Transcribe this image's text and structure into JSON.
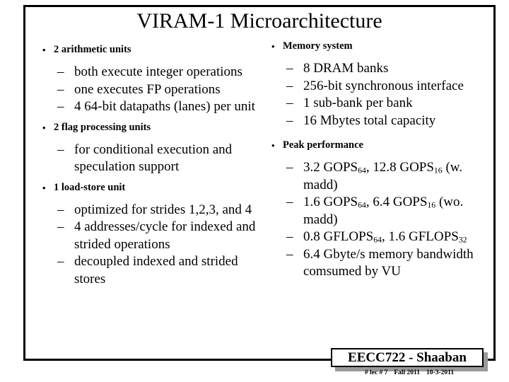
{
  "slide": {
    "title": "VIRAM-1 Microarchitecture",
    "left_column": [
      {
        "type": "bullet",
        "marker": "•",
        "text": "2 arithmetic units",
        "children": [
          {
            "marker": "–",
            "text": "both execute integer operations"
          },
          {
            "marker": "–",
            "text": "one executes FP operations"
          },
          {
            "marker": "–",
            "text": "4 64-bit datapaths (lanes) per unit"
          }
        ]
      },
      {
        "type": "bullet",
        "marker": "•",
        "text": "2 flag processing units",
        "children": [
          {
            "marker": "–",
            "text": "for conditional execution and speculation support"
          }
        ]
      },
      {
        "type": "bullet",
        "marker": "•",
        "text": "1 load-store unit",
        "children": [
          {
            "marker": "–",
            "text": "optimized for strides 1,2,3, and 4"
          },
          {
            "marker": "–",
            "text": "4 addresses/cycle for indexed and strided operations"
          },
          {
            "marker": "–",
            "text": "decoupled indexed and strided stores"
          }
        ]
      }
    ],
    "right_column": [
      {
        "type": "bullet",
        "marker": "•",
        "text": "Memory system",
        "children": [
          {
            "marker": "–",
            "text": "8 DRAM banks"
          },
          {
            "marker": "–",
            "text": "256-bit synchronous interface"
          },
          {
            "marker": "–",
            "text": "1 sub-bank per bank"
          },
          {
            "marker": "–",
            "text": "16 Mbytes total capacity"
          }
        ]
      },
      {
        "type": "bullet",
        "marker": "•",
        "text": "Peak performance",
        "children": [
          {
            "marker": "–",
            "text": "3.2 GOPS64, 12.8 GOPS16 (w. madd)"
          },
          {
            "marker": "–",
            "text": "1.6 GOPS64, 6.4 GOPS16 (wo. madd)"
          },
          {
            "marker": "–",
            "text": "0.8 GFLOPS64, 1.6 GFLOPS32"
          },
          {
            "marker": "–",
            "text": "6.4 Gbyte/s memory bandwidth comsumed by VU"
          }
        ]
      }
    ]
  },
  "footer": {
    "badge_text": "EECC722 - Shaaban",
    "lecture": "#  lec # 7",
    "term": "Fall 2011",
    "date": "10-3-2011"
  },
  "colors": {
    "background": "#ffffff",
    "text": "#000000",
    "frame": "#000000",
    "badge_shadow": "#9a9a9a"
  }
}
